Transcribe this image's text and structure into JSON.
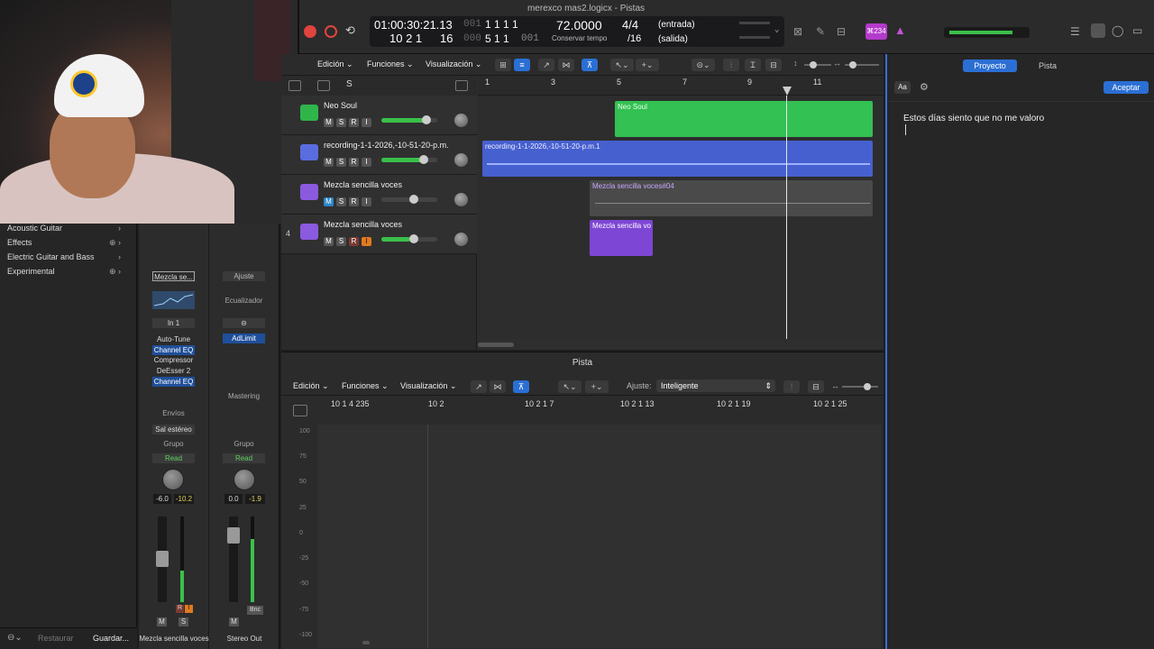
{
  "window": {
    "title": "merexco mas2.logicx - Pistas"
  },
  "lcd": {
    "time": "01:00:30:21.13",
    "bars_top": "1 1 1 1",
    "bars_top_prefix": "001",
    "bars": "10 2 1",
    "ticks": "16",
    "bars_len_prefix": "000",
    "len": "5 1 1",
    "len_ticks": "001",
    "tempo": "72.0000",
    "tempo_label": "Conservar tempo",
    "signature": "4/4",
    "division": "/16",
    "in_label": "(entrada)",
    "out_label": "(salida)",
    "key_badge": "⌘234"
  },
  "library": {
    "items": [
      "Acoustic Guitar",
      "Effects",
      "Electric Guitar and Bass",
      "Experimental"
    ],
    "bottom": {
      "restore": "Restaurar",
      "save": "Guardar..."
    }
  },
  "strip1": {
    "setting": "Mezcla se...",
    "input": "In 1",
    "plugins": [
      "Auto-Tune",
      "Channel EQ",
      "Compressor",
      "DeEsser 2",
      "Channel EQ"
    ],
    "sends_label": "Envíos",
    "output": "Sal estéreo",
    "group": "Grupo",
    "automation": "Read",
    "vol": "-6.0",
    "peak": "-10.2",
    "m": "M",
    "s": "S",
    "r": "R",
    "i": "I",
    "name": "Mezcla sencilla voces"
  },
  "strip2": {
    "setting": "Ajuste",
    "eq": "Ecualizador",
    "plugin": "AdLimit",
    "mastering": "Mastering",
    "group": "Grupo",
    "automation": "Read",
    "vol": "0.0",
    "peak": "-1.9",
    "m": "M",
    "bnc": "Bnc",
    "name": "Stereo Out"
  },
  "arrange": {
    "menus": [
      "Edición",
      "Funciones",
      "Visualización"
    ],
    "ruler": [
      "1",
      "3",
      "5",
      "7",
      "9",
      "11"
    ],
    "s_label": "S",
    "tracks": [
      {
        "num": "",
        "name": "Neo Soul",
        "buttons": [
          "M",
          "S",
          "R",
          "I"
        ]
      },
      {
        "num": "",
        "name": "recording-1-1-2026,-10-51-20-p.m.",
        "buttons": [
          "M",
          "S",
          "R",
          "I"
        ]
      },
      {
        "num": "",
        "name": "Mezcla sencilla voces",
        "buttons": [
          "M",
          "S",
          "R",
          "I"
        ]
      },
      {
        "num": "4",
        "name": "Mezcla sencilla voces",
        "buttons": [
          "M",
          "S",
          "R",
          "I"
        ]
      }
    ],
    "regions": {
      "neo": "Neo Soul",
      "rec": "recording-1-1-2026,-10-51-20-p.m.1",
      "mez4": "Mezcla sencilla voces#04",
      "mez": "Mezcla sencilla vo"
    }
  },
  "notes": {
    "tabs": [
      "Proyecto",
      "Pista"
    ],
    "aa": "Aa",
    "accept": "Aceptar",
    "text": "Estos días siento que no me valoro"
  },
  "editor": {
    "title": "Pista",
    "menus": [
      "Edición",
      "Funciones",
      "Visualización"
    ],
    "snap_label": "Ajuste:",
    "snap_value": "Inteligente",
    "xlabels": [
      "10 1 4 235",
      "10 2",
      "10 2 1 7",
      "10 2 1 13",
      "10 2 1 19",
      "10 2 1 25"
    ],
    "ylabels": [
      "100",
      "75",
      "50",
      "25",
      "0",
      "-25",
      "-50",
      "-75",
      "-100"
    ]
  }
}
